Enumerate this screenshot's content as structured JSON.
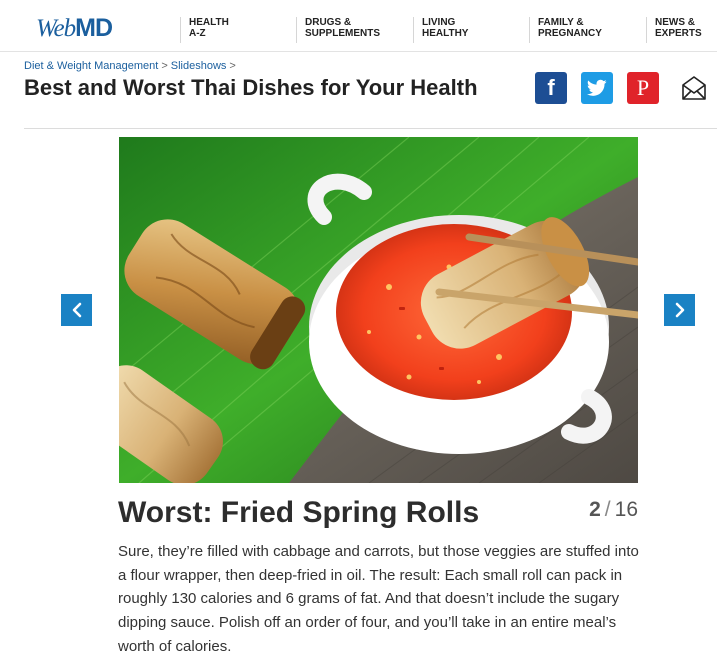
{
  "header": {
    "logo_web": "Web",
    "logo_md": "MD",
    "nav": [
      {
        "label": "HEALTH\nA-Z"
      },
      {
        "label": "DRUGS &\nSUPPLEMENTS"
      },
      {
        "label": "LIVING\nHEALTHY"
      },
      {
        "label": "FAMILY &\nPREGNANCY"
      },
      {
        "label": "NEWS &\nEXPERTS"
      }
    ]
  },
  "breadcrumb": {
    "items": [
      "Diet & Weight Management",
      "Slideshows"
    ],
    "separator": ">"
  },
  "page": {
    "title": "Best and Worst Thai Dishes for Your Health"
  },
  "share": {
    "facebook": "f",
    "twitter_icon": "twitter-bird",
    "pinterest": "P",
    "email_icon": "envelope"
  },
  "slide": {
    "title": "Worst: Fried Spring Rolls",
    "current": "2",
    "separator": "/",
    "total": "16",
    "body": "Sure, they’re filled with cabbage and carrots, but those veggies are stuffed into a flour wrapper, then deep-fried in oil. The result: Each small roll can pack in roughly 130 calories and 6 grams of fat. And that doesn’t include the sugary dipping sauce. Polish off an order of four, and you’ll take in an entire meal’s worth of calories."
  },
  "colors": {
    "brand_blue": "#1b5f9e",
    "arrow_blue": "#1a82c4",
    "facebook": "#1d4e94",
    "twitter": "#1e9ce5",
    "pinterest": "#e0232a"
  }
}
